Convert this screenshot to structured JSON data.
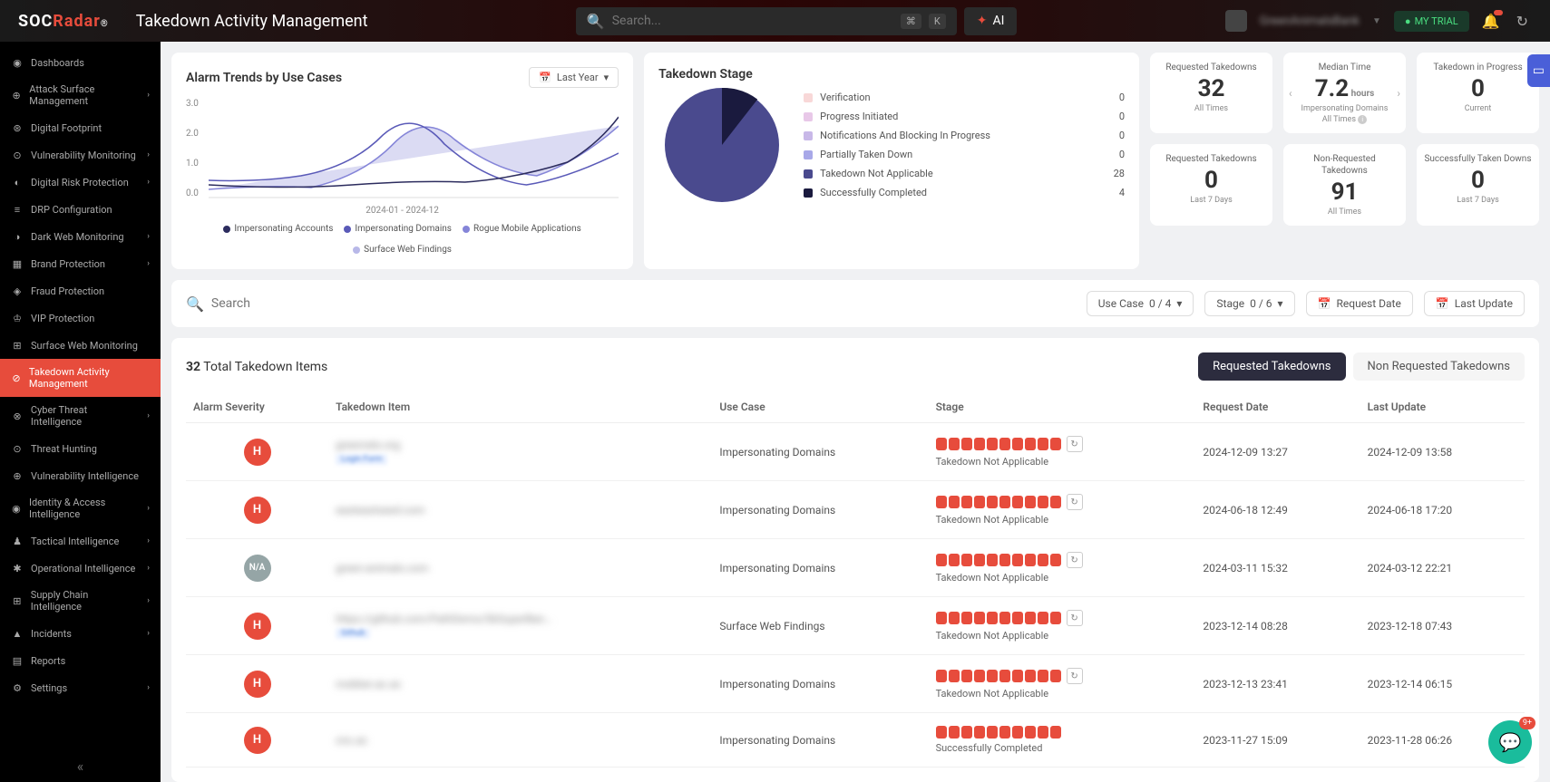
{
  "brand": "SOCRadar",
  "page_title": "Takedown Activity Management",
  "search_placeholder": "Search...",
  "kbd1": "⌘",
  "kbd2": "K",
  "ai_label": "AI",
  "org_name": "GreenAnimalsBank",
  "trial_label": "MY TRIAL",
  "sidebar": {
    "items": [
      {
        "label": "Dashboards",
        "icon": "◉"
      },
      {
        "label": "Attack Surface Management",
        "icon": "⊕",
        "sub": true
      },
      {
        "label": "Digital Footprint",
        "icon": "⊛",
        "indent": true
      },
      {
        "label": "Vulnerability Monitoring",
        "icon": "⊙",
        "indent": true,
        "sub": true
      },
      {
        "label": "Digital Risk Protection",
        "icon": "◐",
        "sub": true
      },
      {
        "label": "DRP Configuration",
        "icon": "≡",
        "indent": true
      },
      {
        "label": "Dark Web Monitoring",
        "icon": "◑",
        "indent": true,
        "sub": true
      },
      {
        "label": "Brand Protection",
        "icon": "▦",
        "indent": true,
        "sub": true
      },
      {
        "label": "Fraud Protection",
        "icon": "◈",
        "indent": true
      },
      {
        "label": "VIP Protection",
        "icon": "♔",
        "indent": true
      },
      {
        "label": "Surface Web Monitoring",
        "icon": "⊞",
        "indent": true
      },
      {
        "label": "Takedown Activity Management",
        "icon": "⊘",
        "indent": true,
        "active": true
      },
      {
        "label": "Cyber Threat Intelligence",
        "icon": "⊗",
        "sub": true
      },
      {
        "label": "Threat Hunting",
        "icon": "⊙",
        "indent": true
      },
      {
        "label": "Vulnerability Intelligence",
        "icon": "⊕",
        "indent": true
      },
      {
        "label": "Identity & Access Intelligence",
        "icon": "◉",
        "indent": true,
        "sub": true
      },
      {
        "label": "Tactical Intelligence",
        "icon": "♟",
        "indent": true,
        "sub": true
      },
      {
        "label": "Operational Intelligence",
        "icon": "✱",
        "indent": true,
        "sub": true
      },
      {
        "label": "Supply Chain Intelligence",
        "icon": "⊞",
        "sub": true
      },
      {
        "label": "Incidents",
        "icon": "▲",
        "sub": true
      },
      {
        "label": "Reports",
        "icon": "▤"
      },
      {
        "label": "Settings",
        "icon": "⚙",
        "sub": true
      }
    ]
  },
  "trends": {
    "title": "Alarm Trends by Use Cases",
    "date_label": "Last Year",
    "y_labels": [
      "3.0",
      "2.0",
      "1.0",
      "0.0"
    ],
    "x_label": "2024-01 - 2024-12",
    "legend": [
      {
        "label": "Impersonating Accounts",
        "color": "#2c2c5e"
      },
      {
        "label": "Impersonating Domains",
        "color": "#5a5ab8"
      },
      {
        "label": "Rogue Mobile Applications",
        "color": "#8585d8"
      },
      {
        "label": "Surface Web Findings",
        "color": "#b8b8e8"
      }
    ]
  },
  "stage": {
    "title": "Takedown Stage",
    "items": [
      {
        "label": "Verification",
        "value": "0",
        "color": "#f8d8d8"
      },
      {
        "label": "Progress Initiated",
        "value": "0",
        "color": "#e8c8e8"
      },
      {
        "label": "Notifications And Blocking In Progress",
        "value": "0",
        "color": "#c8b8e8"
      },
      {
        "label": "Partially Taken Down",
        "value": "0",
        "color": "#a8a8e8"
      },
      {
        "label": "Takedown Not Applicable",
        "value": "28",
        "color": "#4a4a8e"
      },
      {
        "label": "Successfully Completed",
        "value": "4",
        "color": "#1a1a3e"
      }
    ]
  },
  "stats": [
    {
      "label": "Requested Takedowns",
      "value": "32",
      "sub": "All Times"
    },
    {
      "label": "Median Time",
      "value": "7.2",
      "unit": "hours",
      "sub": "Impersonating Domains",
      "sub2": "All Times",
      "arrows": true,
      "info": true
    },
    {
      "label": "Takedown in Progress",
      "value": "0",
      "sub": "Current"
    },
    {
      "label": "Requested Takedowns",
      "value": "0",
      "sub": "Last 7 Days"
    },
    {
      "label": "Non-Requested Takedowns",
      "value": "91",
      "sub": "All Times"
    },
    {
      "label": "Successfully Taken Downs",
      "value": "0",
      "sub": "Last 7 Days"
    }
  ],
  "filters": {
    "search_placeholder": "Search",
    "use_case": {
      "label": "Use Case",
      "count": "0 / 4"
    },
    "stage_f": {
      "label": "Stage",
      "count": "0 / 6"
    },
    "req_date": "Request Date",
    "last_update": "Last Update"
  },
  "table": {
    "total_count": "32",
    "total_label": "Total Takedown Items",
    "tab1": "Requested Takedowns",
    "tab2": "Non Requested Takedowns",
    "cols": [
      "Alarm Severity",
      "Takedown Item",
      "Use Case",
      "Stage",
      "Request Date",
      "Last Update"
    ],
    "rows": [
      {
        "sev": "H",
        "item": "greenrats.org",
        "tag": "Login Form",
        "use_case": "Impersonating Domains",
        "stage": "Takedown Not Applicable",
        "refresh": true,
        "req": "2024-12-09 13:27",
        "upd": "2024-12-09 13:58"
      },
      {
        "sev": "H",
        "item": "easteastseed.com",
        "tag": "",
        "use_case": "Impersonating Domains",
        "stage": "Takedown Not Applicable",
        "refresh": true,
        "req": "2024-06-18 12:49",
        "upd": "2024-06-18 17:20"
      },
      {
        "sev": "N/A",
        "item": "green-animals.com",
        "tag": "",
        "use_case": "Impersonating Domains",
        "stage": "Takedown Not Applicable",
        "refresh": true,
        "req": "2024-03-11 15:32",
        "upd": "2024-03-12 22:21"
      },
      {
        "sev": "H",
        "item": "https://github.com/PathDemo/SkSuperBan...",
        "tag": "Github",
        "use_case": "Surface Web Findings",
        "stage": "Takedown Not Applicable",
        "refresh": true,
        "req": "2023-12-14 08:28",
        "upd": "2023-12-18 07:43"
      },
      {
        "sev": "H",
        "item": "mobber.ac.ac",
        "tag": "",
        "use_case": "Impersonating Domains",
        "stage": "Takedown Not Applicable",
        "refresh": true,
        "req": "2023-12-13 23:41",
        "upd": "2023-12-14 06:15"
      },
      {
        "sev": "H",
        "item": "cnc.ac",
        "tag": "",
        "use_case": "Impersonating Domains",
        "stage": "Successfully Completed",
        "refresh": false,
        "req": "2023-11-27 15:09",
        "upd": "2023-11-28 06:26"
      }
    ]
  },
  "chat_badge": "9+",
  "chart_data": {
    "type": "line",
    "title": "Alarm Trends by Use Cases",
    "x_range": "2024-01 - 2024-12",
    "ylim": [
      0,
      3.0
    ],
    "series": [
      {
        "name": "Impersonating Accounts",
        "color": "#2c2c5e"
      },
      {
        "name": "Impersonating Domains",
        "color": "#5a5ab8"
      },
      {
        "name": "Rogue Mobile Applications",
        "color": "#8585d8"
      },
      {
        "name": "Surface Web Findings",
        "color": "#b8b8e8"
      }
    ],
    "pie": {
      "type": "pie",
      "title": "Takedown Stage",
      "slices": [
        {
          "label": "Verification",
          "value": 0
        },
        {
          "label": "Progress Initiated",
          "value": 0
        },
        {
          "label": "Notifications And Blocking In Progress",
          "value": 0
        },
        {
          "label": "Partially Taken Down",
          "value": 0
        },
        {
          "label": "Takedown Not Applicable",
          "value": 28
        },
        {
          "label": "Successfully Completed",
          "value": 4
        }
      ]
    }
  }
}
